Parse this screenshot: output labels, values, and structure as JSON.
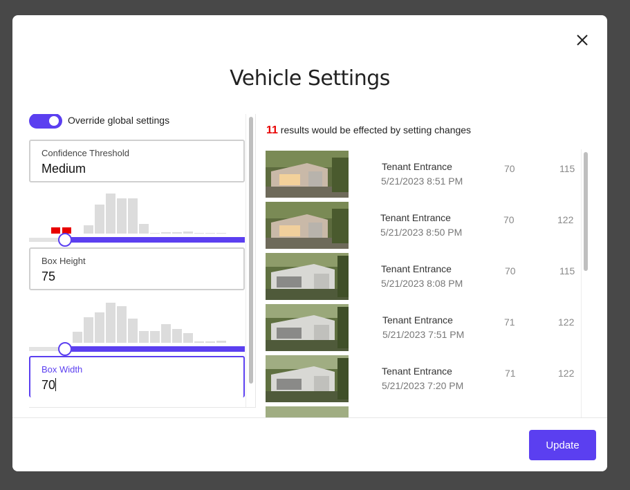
{
  "modal": {
    "title": "Vehicle Settings",
    "close_icon": "close-icon"
  },
  "settings": {
    "override_label": "Override global settings",
    "override_on": true,
    "confidence": {
      "label": "Confidence Threshold",
      "value": "Medium"
    },
    "box_height": {
      "label": "Box Height",
      "value": "75"
    },
    "box_width": {
      "label": "Box Width",
      "value": "70"
    }
  },
  "results": {
    "count": "11",
    "summary_text": " results would be effected by setting changes",
    "rows": [
      {
        "name": "Tenant Entrance",
        "time": "5/21/2023 8:51 PM",
        "col1": "70",
        "col2": "115"
      },
      {
        "name": "Tenant Entrance",
        "time": "5/21/2023 8:50 PM",
        "col1": "70",
        "col2": "122"
      },
      {
        "name": "Tenant Entrance",
        "time": "5/21/2023 8:08 PM",
        "col1": "70",
        "col2": "115"
      },
      {
        "name": "Tenant Entrance",
        "time": "5/21/2023 7:51 PM",
        "col1": "71",
        "col2": "122"
      },
      {
        "name": "Tenant Entrance",
        "time": "5/21/2023 7:20 PM",
        "col1": "71",
        "col2": "122"
      }
    ]
  },
  "footer": {
    "update_label": "Update"
  },
  "colors": {
    "accent": "#5b3ff0",
    "highlight": "#e80000",
    "histogram": "#dcdcdc"
  }
}
